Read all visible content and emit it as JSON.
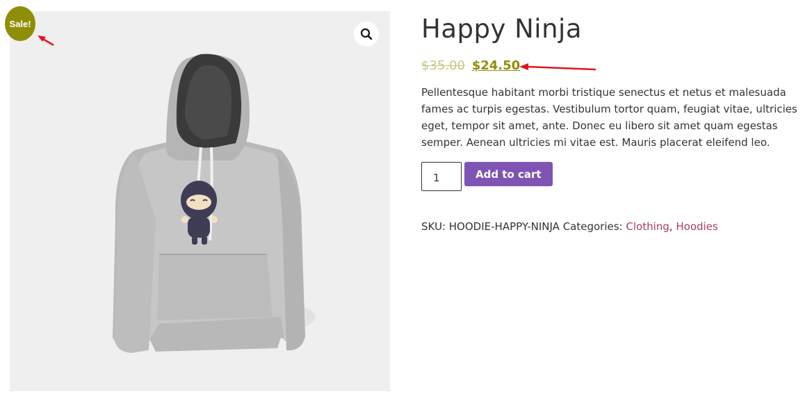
{
  "colors": {
    "sale_badge": "#8f8e08",
    "price": "#8f8e08",
    "button": "#7f54b3",
    "link": "#a93c6a",
    "annotation": "#e0161d",
    "gallery_bg": "#efefef"
  },
  "gallery": {
    "image_alt": "Grey hoodie with ninja logo",
    "zoom_icon": "magnifier-icon"
  },
  "badge": {
    "label": "Sale!"
  },
  "product": {
    "title": "Happy Ninja",
    "price_old": "$35.00",
    "price_new": "$24.50",
    "description": "Pellentesque habitant morbi tristique senectus et netus et malesuada fames ac turpis egestas. Vestibulum tortor quam, feugiat vitae, ultricies eget, tempor sit amet, ante. Donec eu libero sit amet quam egestas semper. Aenean ultricies mi vitae est. Mauris placerat eleifend leo.",
    "quantity": "1",
    "add_to_cart_label": "Add to cart"
  },
  "meta": {
    "sku_label": "SKU:",
    "sku_value": "HOODIE-HAPPY-NINJA",
    "categories_label": "Categories:",
    "categories": [
      "Clothing",
      "Hoodies"
    ],
    "separator": ","
  }
}
